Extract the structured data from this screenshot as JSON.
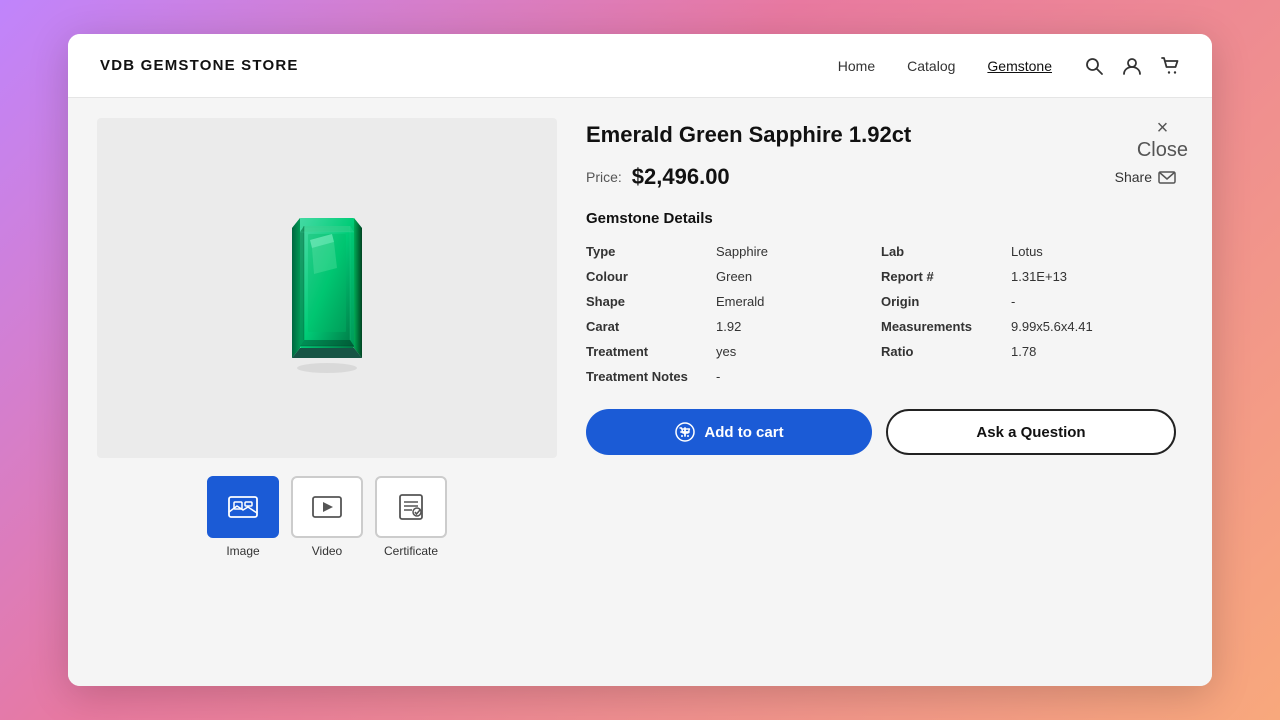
{
  "header": {
    "logo": "VDB GEMSTONE STORE",
    "nav": [
      {
        "label": "Home",
        "active": false
      },
      {
        "label": "Catalog",
        "active": false
      },
      {
        "label": "Gemstone",
        "active": true
      }
    ],
    "icons": [
      "search-icon",
      "user-icon",
      "cart-icon"
    ]
  },
  "product": {
    "title": "Emerald Green Sapphire 1.92ct",
    "price_label": "Price:",
    "price": "$2,496.00",
    "share_label": "Share",
    "details_title": "Gemstone Details",
    "left_details": [
      {
        "key": "Type",
        "value": "Sapphire"
      },
      {
        "key": "Colour",
        "value": "Green"
      },
      {
        "key": "Shape",
        "value": "Emerald"
      },
      {
        "key": "Carat",
        "value": "1.92"
      },
      {
        "key": "Treatment",
        "value": "yes"
      },
      {
        "key": "Treatment Notes",
        "value": "-"
      }
    ],
    "right_details": [
      {
        "key": "Lab",
        "value": "Lotus"
      },
      {
        "key": "Report #",
        "value": "1.31E+13"
      },
      {
        "key": "Origin",
        "value": "-"
      },
      {
        "key": "Measurements",
        "value": "9.99x5.6x4.41"
      },
      {
        "key": "Ratio",
        "value": "1.78"
      }
    ],
    "close_label": "Close",
    "media_tabs": [
      {
        "label": "Image",
        "active": true
      },
      {
        "label": "Video",
        "active": false
      },
      {
        "label": "Certificate",
        "active": false
      }
    ],
    "add_to_cart_label": "Add to cart",
    "ask_question_label": "Ask a Question"
  }
}
